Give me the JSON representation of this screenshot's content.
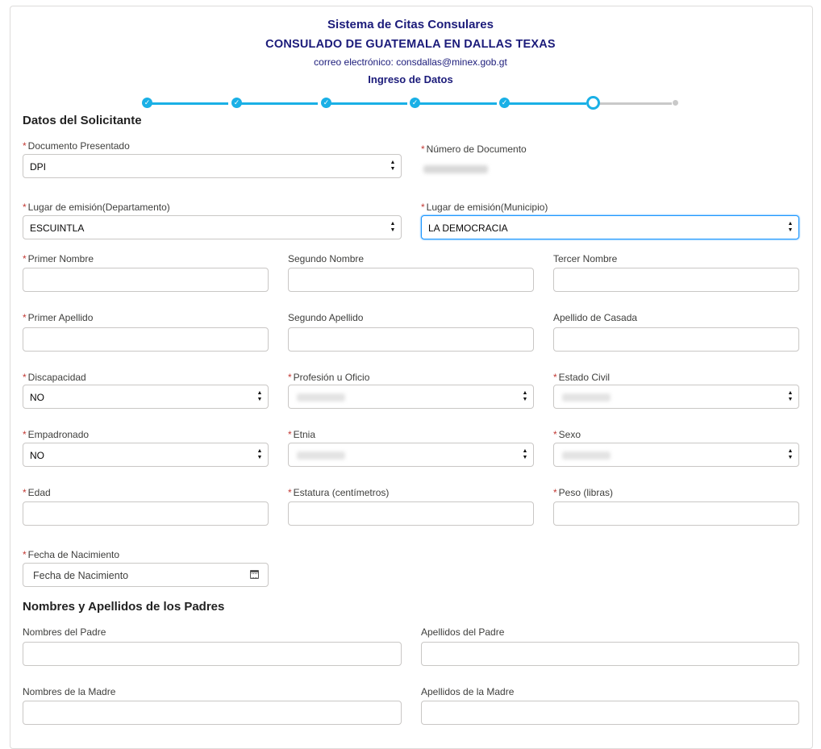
{
  "header": {
    "system_title": "Sistema de Citas Consulares",
    "consulate": "CONSULADO DE GUATEMALA EN DALLAS TEXAS",
    "email": "correo electrónico: consdallas@minex.gob.gt",
    "step_title": "Ingreso de Datos"
  },
  "stepper": {
    "completed_steps": 5,
    "current_step": 6,
    "total_steps": 7
  },
  "sections": {
    "applicant": "Datos del Solicitante",
    "parents": "Nombres y Apellidos de los Padres"
  },
  "required_mark": "*",
  "fields": {
    "documento": {
      "label": "Documento Presentado",
      "value": "DPI"
    },
    "numero_documento": {
      "label": "Número de Documento"
    },
    "lugar_departamento": {
      "label": "Lugar de emisión(Departamento)",
      "value": "ESCUINTLA"
    },
    "lugar_municipio": {
      "label": "Lugar de emisión(Municipio)",
      "value": "LA DEMOCRACIA"
    },
    "primer_nombre": {
      "label": "Primer Nombre",
      "value": ""
    },
    "segundo_nombre": {
      "label": "Segundo Nombre",
      "value": ""
    },
    "tercer_nombre": {
      "label": "Tercer Nombre",
      "value": ""
    },
    "primer_apellido": {
      "label": "Primer Apellido",
      "value": ""
    },
    "segundo_apellido": {
      "label": "Segundo Apellido",
      "value": ""
    },
    "apellido_casada": {
      "label": "Apellido de Casada",
      "value": ""
    },
    "discapacidad": {
      "label": "Discapacidad",
      "value": "NO"
    },
    "profesion": {
      "label": "Profesión u Oficio"
    },
    "estado_civil": {
      "label": "Estado Civil"
    },
    "empadronado": {
      "label": "Empadronado",
      "value": "NO"
    },
    "etnia": {
      "label": "Etnia"
    },
    "sexo": {
      "label": "Sexo"
    },
    "edad": {
      "label": "Edad",
      "value": ""
    },
    "estatura": {
      "label": "Estatura (centímetros)",
      "value": ""
    },
    "peso": {
      "label": "Peso (libras)",
      "value": ""
    },
    "fecha_nacimiento": {
      "label": "Fecha de Nacimiento",
      "placeholder": "Fecha de Nacimiento"
    },
    "nombres_padre": {
      "label": "Nombres del Padre",
      "value": ""
    },
    "apellidos_padre": {
      "label": "Apellidos del Padre",
      "value": ""
    },
    "nombres_madre": {
      "label": "Nombres de la Madre",
      "value": ""
    },
    "apellidos_madre": {
      "label": "Apellidos de la Madre",
      "value": ""
    }
  }
}
